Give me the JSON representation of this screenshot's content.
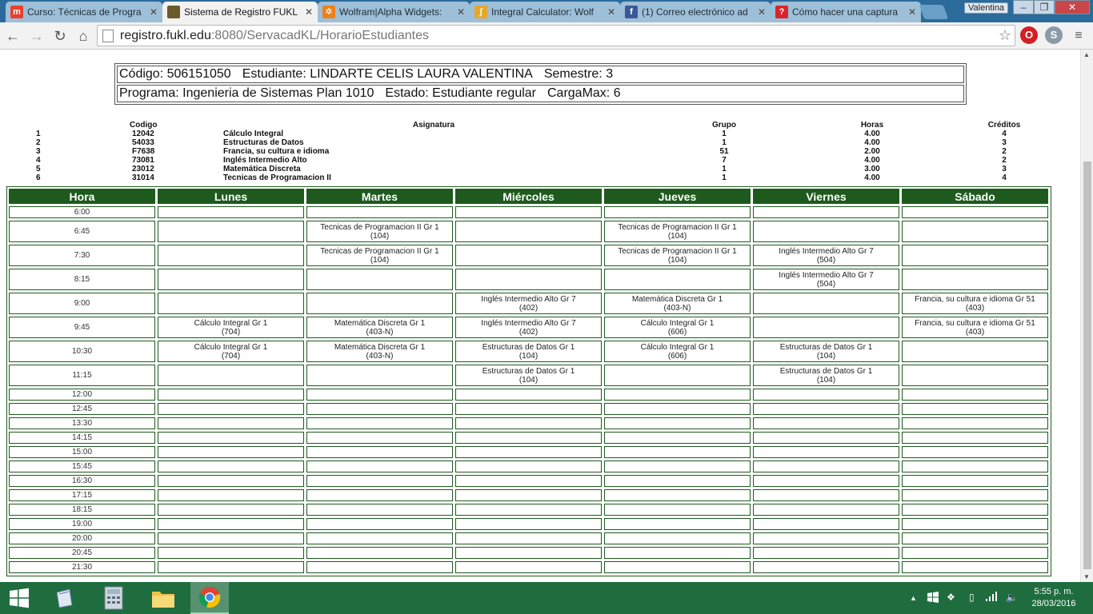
{
  "browser": {
    "tabs": [
      {
        "label": "Curso: Técnicas de Progra",
        "icon": "moodle-icon",
        "color": "#e8402c",
        "glyph": "m",
        "active": false
      },
      {
        "label": "Sistema de Registro FUKL",
        "icon": "registry-icon",
        "color": "#6b5a2a",
        "glyph": "",
        "active": true
      },
      {
        "label": "Wolfram|Alpha Widgets:",
        "icon": "wolfram-icon",
        "color": "#ef7f1a",
        "glyph": "✲",
        "active": false
      },
      {
        "label": "Integral Calculator: Wolf",
        "icon": "integral-icon",
        "color": "#e8a628",
        "glyph": "∫",
        "active": false
      },
      {
        "label": "(1) Correo electrónico ad",
        "icon": "facebook-icon",
        "color": "#3b5998",
        "glyph": "f",
        "active": false
      },
      {
        "label": "Cómo hacer una captura",
        "icon": "question-icon",
        "color": "#d6262a",
        "glyph": "?",
        "active": false
      }
    ],
    "profile": "Valentina",
    "url_host": "registro.fukl.edu",
    "url_rest": ":8080/ServacadKL/HorarioEstudiantes"
  },
  "student": {
    "code_label": "Código:",
    "code": "506151050",
    "name_label": "Estudiante:",
    "name": "LINDARTE CELIS LAURA VALENTINA",
    "semester_label": "Semestre:",
    "semester": "3",
    "program_label": "Programa:",
    "program": "Ingenieria de Sistemas Plan 1010",
    "status_label": "Estado:",
    "status": "Estudiante regular",
    "load_label": "CargaMax:",
    "load": "6"
  },
  "subjects": {
    "headers": {
      "code": "Codigo",
      "name": "Asignatura",
      "group": "Grupo",
      "hours": "Horas",
      "credits": "Créditos"
    },
    "rows": [
      {
        "idx": "1",
        "code": "12042",
        "name": "Cálculo Integral",
        "group": "1",
        "hours": "4.00",
        "credits": "4"
      },
      {
        "idx": "2",
        "code": "54033",
        "name": "Estructuras de Datos",
        "group": "1",
        "hours": "4.00",
        "credits": "3"
      },
      {
        "idx": "3",
        "code": "F7638",
        "name": "Francia, su cultura e idioma",
        "group": "51",
        "hours": "2.00",
        "credits": "2"
      },
      {
        "idx": "4",
        "code": "73081",
        "name": "Inglés Intermedio Alto",
        "group": "7",
        "hours": "4.00",
        "credits": "2"
      },
      {
        "idx": "5",
        "code": "23012",
        "name": "Matemática Discreta",
        "group": "1",
        "hours": "3.00",
        "credits": "3"
      },
      {
        "idx": "6",
        "code": "31014",
        "name": "Tecnicas de Programacion II",
        "group": "1",
        "hours": "4.00",
        "credits": "4"
      }
    ]
  },
  "schedule": {
    "headers": [
      "Hora",
      "Lunes",
      "Martes",
      "Miércoles",
      "Jueves",
      "Viernes",
      "Sábado"
    ],
    "rows": [
      {
        "time": "6:00",
        "cells": [
          "",
          "",
          "",
          "",
          "",
          ""
        ]
      },
      {
        "time": "6:45",
        "cells": [
          "",
          "Tecnicas de Programacion II Gr 1|(104)",
          "",
          "Tecnicas de Programacion II Gr 1|(104)",
          "",
          ""
        ]
      },
      {
        "time": "7:30",
        "cells": [
          "",
          "Tecnicas de Programacion II Gr 1|(104)",
          "",
          "Tecnicas de Programacion II Gr 1|(104)",
          "Inglés Intermedio Alto Gr 7|(504)",
          ""
        ]
      },
      {
        "time": "8:15",
        "cells": [
          "",
          "",
          "",
          "",
          "Inglés Intermedio Alto Gr 7|(504)",
          ""
        ]
      },
      {
        "time": "9:00",
        "cells": [
          "",
          "",
          "Inglés Intermedio Alto Gr 7|(402)",
          "Matemática Discreta Gr 1|(403-N)",
          "",
          "Francia, su cultura e idioma Gr 51|(403)"
        ]
      },
      {
        "time": "9:45",
        "cells": [
          "Cálculo Integral Gr 1|(704)",
          "Matemática Discreta Gr 1|(403-N)",
          "Inglés Intermedio Alto Gr 7|(402)",
          "Cálculo Integral Gr 1|(606)",
          "",
          "Francia, su cultura e idioma Gr 51|(403)"
        ]
      },
      {
        "time": "10:30",
        "cells": [
          "Cálculo Integral Gr 1|(704)",
          "Matemática Discreta Gr 1|(403-N)",
          "Estructuras de Datos Gr 1|(104)",
          "Cálculo Integral Gr 1|(606)",
          "Estructuras de Datos Gr 1|(104)",
          ""
        ]
      },
      {
        "time": "11:15",
        "cells": [
          "",
          "",
          "Estructuras de Datos Gr 1|(104)",
          "",
          "Estructuras de Datos Gr 1|(104)",
          ""
        ]
      },
      {
        "time": "12:00",
        "cells": [
          "",
          "",
          "",
          "",
          "",
          ""
        ]
      },
      {
        "time": "12:45",
        "cells": [
          "",
          "",
          "",
          "",
          "",
          ""
        ]
      },
      {
        "time": "13:30",
        "cells": [
          "",
          "",
          "",
          "",
          "",
          ""
        ]
      },
      {
        "time": "14:15",
        "cells": [
          "",
          "",
          "",
          "",
          "",
          ""
        ]
      },
      {
        "time": "15:00",
        "cells": [
          "",
          "",
          "",
          "",
          "",
          ""
        ]
      },
      {
        "time": "15:45",
        "cells": [
          "",
          "",
          "",
          "",
          "",
          ""
        ]
      },
      {
        "time": "16:30",
        "cells": [
          "",
          "",
          "",
          "",
          "",
          ""
        ]
      },
      {
        "time": "17:15",
        "cells": [
          "",
          "",
          "",
          "",
          "",
          ""
        ]
      },
      {
        "time": "18:15",
        "cells": [
          "",
          "",
          "",
          "",
          "",
          ""
        ]
      },
      {
        "time": "19:00",
        "cells": [
          "",
          "",
          "",
          "",
          "",
          ""
        ]
      },
      {
        "time": "20:00",
        "cells": [
          "",
          "",
          "",
          "",
          "",
          ""
        ]
      },
      {
        "time": "20:45",
        "cells": [
          "",
          "",
          "",
          "",
          "",
          ""
        ]
      },
      {
        "time": "21:30",
        "cells": [
          "",
          "",
          "",
          "",
          "",
          ""
        ]
      }
    ]
  },
  "taskbar": {
    "time": "5:55 p. m.",
    "date": "28/03/2016"
  },
  "colors": {
    "header_green": "#1e5a1e",
    "taskbar": "#1f6d3f",
    "tabstrip": "#2b6b9b"
  }
}
